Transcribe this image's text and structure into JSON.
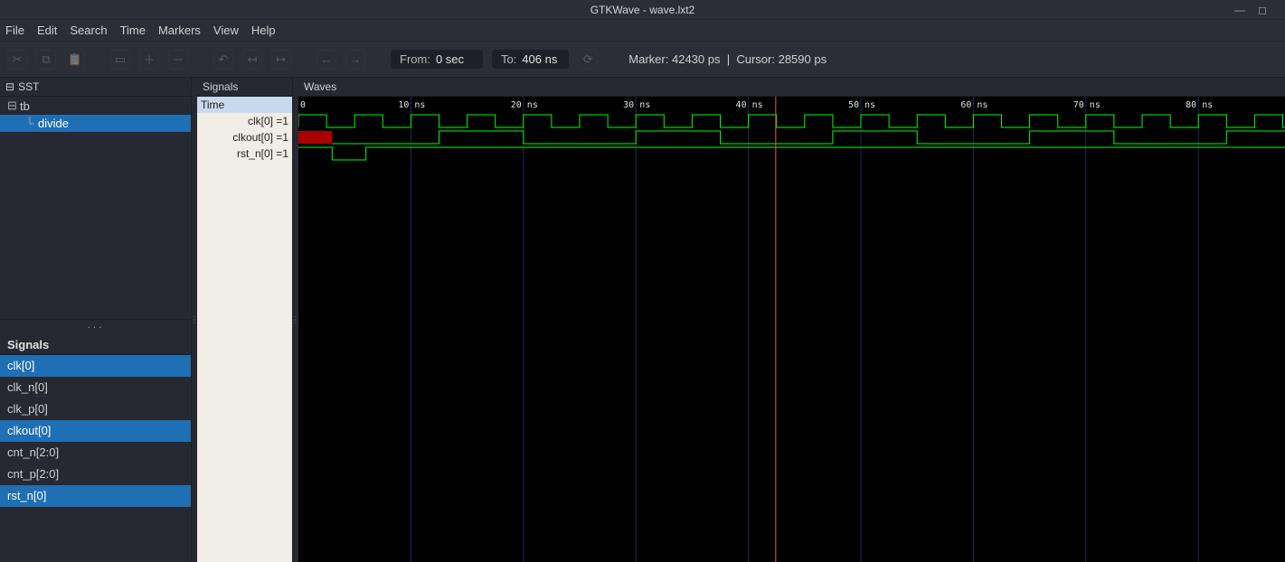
{
  "window": {
    "title": "GTKWave - wave.lxt2",
    "controls": {
      "min": "—",
      "max": "◻",
      "close": ""
    }
  },
  "menu": [
    "File",
    "Edit",
    "Search",
    "Time",
    "Markers",
    "View",
    "Help"
  ],
  "toolbar": {
    "from_label": "From:",
    "from_value": "0 sec",
    "to_label": "To:",
    "to_value": "406 ns",
    "marker_label": "Marker:",
    "marker_value": "42430 ps",
    "sep": "|",
    "cursor_label": "Cursor:",
    "cursor_value": "28590 ps"
  },
  "sst": {
    "title": "SST",
    "tree": [
      {
        "icon": "⊟",
        "label": "tb",
        "selected": false
      },
      {
        "icon": "└",
        "label": "divide",
        "selected": true,
        "child": true
      }
    ]
  },
  "siglist": {
    "title": "Signals",
    "items": [
      {
        "name": "clk[0]",
        "selected": true
      },
      {
        "name": "clk_n[0]",
        "selected": false
      },
      {
        "name": "clk_p[0]",
        "selected": false
      },
      {
        "name": "clkout[0]",
        "selected": true
      },
      {
        "name": "cnt_n[2:0]",
        "selected": false
      },
      {
        "name": "cnt_p[2:0]",
        "selected": false
      },
      {
        "name": "rst_n[0]",
        "selected": true
      }
    ]
  },
  "sigcol": {
    "title": "Signals",
    "rows": [
      {
        "label": "Time",
        "first": true
      },
      {
        "label": "clk[0] =1"
      },
      {
        "label": "clkout[0] =1"
      },
      {
        "label": "rst_n[0] =1"
      }
    ]
  },
  "waves": {
    "title": "Waves",
    "unit": "ns",
    "x_start": 0,
    "x_end": 87.7,
    "ticks": [
      10,
      20,
      30,
      40,
      50,
      60,
      70,
      80
    ],
    "marker_x_ns": 42.43,
    "rows": [
      {
        "name": "clk",
        "type": "clock",
        "period_ns": 5,
        "duty": 0.5,
        "phase_ns": 0,
        "undef_until_ns": 0
      },
      {
        "name": "clkout",
        "type": "pulse",
        "undef_until_ns": 3,
        "low_after_undef_until_ns": 12.5,
        "period_ns": 17.5,
        "high_ns": 7.5
      },
      {
        "name": "rst_n",
        "type": "edges",
        "edges_ns": [
          0,
          3,
          6
        ],
        "initial": 1
      }
    ]
  }
}
